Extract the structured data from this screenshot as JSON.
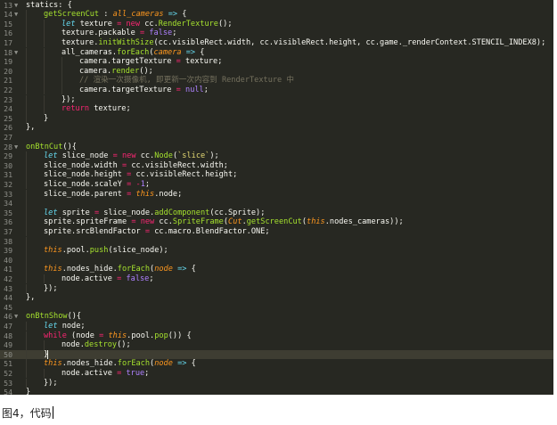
{
  "editor": {
    "theme_colors": {
      "background": "#272822",
      "keyword": "#f92672",
      "string": "#e6db74",
      "function": "#a6e22e",
      "comment": "#75715e"
    },
    "active_line_number": 50,
    "lines": [
      {
        "num": "13",
        "fold": "▼",
        "indent": 1,
        "tokens": [
          [
            "pr",
            "statics: {"
          ]
        ]
      },
      {
        "num": "14",
        "fold": "▼",
        "indent": 2,
        "tokens": [
          [
            "fn",
            "getScreenCut"
          ],
          [
            "pr",
            " : "
          ],
          [
            "pa",
            "all_cameras"
          ],
          [
            "pr",
            " "
          ],
          [
            "st",
            "=>"
          ],
          [
            "pr",
            " {"
          ]
        ]
      },
      {
        "num": "15",
        "fold": "",
        "indent": 3,
        "tokens": [
          [
            "st",
            "let"
          ],
          [
            "pr",
            " texture "
          ],
          [
            "kw",
            "="
          ],
          [
            "pr",
            " "
          ],
          [
            "kw",
            "new"
          ],
          [
            "pr",
            " cc."
          ],
          [
            "fn",
            "RenderTexture"
          ],
          [
            "pr",
            "();"
          ]
        ]
      },
      {
        "num": "16",
        "fold": "",
        "indent": 3,
        "tokens": [
          [
            "pr",
            "texture.packable "
          ],
          [
            "kw",
            "="
          ],
          [
            "pr",
            " "
          ],
          [
            "nu",
            "false"
          ],
          [
            "pr",
            ";"
          ]
        ]
      },
      {
        "num": "17",
        "fold": "",
        "indent": 3,
        "tokens": [
          [
            "pr",
            "texture."
          ],
          [
            "fn",
            "initWithSize"
          ],
          [
            "pr",
            "(cc.visibleRect.width, cc.visibleRect.height, cc.game._renderContext.STENCIL_INDEX8);"
          ]
        ]
      },
      {
        "num": "18",
        "fold": "▼",
        "indent": 3,
        "tokens": [
          [
            "pr",
            "all_cameras."
          ],
          [
            "fn",
            "forEach"
          ],
          [
            "pr",
            "("
          ],
          [
            "pa",
            "camera"
          ],
          [
            "pr",
            " "
          ],
          [
            "st",
            "=>"
          ],
          [
            "pr",
            " {"
          ]
        ]
      },
      {
        "num": "19",
        "fold": "",
        "indent": 4,
        "tokens": [
          [
            "pr",
            "camera.targetTexture "
          ],
          [
            "kw",
            "="
          ],
          [
            "pr",
            " texture;"
          ]
        ]
      },
      {
        "num": "20",
        "fold": "",
        "indent": 4,
        "tokens": [
          [
            "pr",
            "camera."
          ],
          [
            "fn",
            "render"
          ],
          [
            "pr",
            "();"
          ]
        ]
      },
      {
        "num": "21",
        "fold": "",
        "indent": 4,
        "tokens": [
          [
            "cm",
            "// 渲染一次摄像机, 即更新一次内容到 RenderTexture 中"
          ]
        ]
      },
      {
        "num": "22",
        "fold": "",
        "indent": 4,
        "tokens": [
          [
            "pr",
            "camera.targetTexture "
          ],
          [
            "kw",
            "="
          ],
          [
            "pr",
            " "
          ],
          [
            "nu",
            "null"
          ],
          [
            "pr",
            ";"
          ]
        ]
      },
      {
        "num": "23",
        "fold": "",
        "indent": 3,
        "tokens": [
          [
            "pr",
            "});"
          ]
        ]
      },
      {
        "num": "24",
        "fold": "",
        "indent": 3,
        "tokens": [
          [
            "kw",
            "return"
          ],
          [
            "pr",
            " texture;"
          ]
        ]
      },
      {
        "num": "25",
        "fold": "",
        "indent": 2,
        "tokens": [
          [
            "pr",
            "}"
          ]
        ]
      },
      {
        "num": "26",
        "fold": "",
        "indent": 1,
        "tokens": [
          [
            "pr",
            "},"
          ]
        ]
      },
      {
        "num": "27",
        "fold": "",
        "indent": 1,
        "tokens": []
      },
      {
        "num": "28",
        "fold": "▼",
        "indent": 1,
        "tokens": [
          [
            "fn",
            "onBtnCut"
          ],
          [
            "pr",
            "(){"
          ]
        ]
      },
      {
        "num": "29",
        "fold": "",
        "indent": 2,
        "tokens": [
          [
            "st",
            "let"
          ],
          [
            "pr",
            " slice_node "
          ],
          [
            "kw",
            "="
          ],
          [
            "pr",
            " "
          ],
          [
            "kw",
            "new"
          ],
          [
            "pr",
            " cc."
          ],
          [
            "fn",
            "Node"
          ],
          [
            "pr",
            "("
          ],
          [
            "sg",
            "`slice`"
          ],
          [
            "pr",
            ");"
          ]
        ]
      },
      {
        "num": "30",
        "fold": "",
        "indent": 2,
        "tokens": [
          [
            "pr",
            "slice_node.width "
          ],
          [
            "kw",
            "="
          ],
          [
            "pr",
            " cc.visibleRect.width;"
          ]
        ]
      },
      {
        "num": "31",
        "fold": "",
        "indent": 2,
        "tokens": [
          [
            "pr",
            "slice_node.height "
          ],
          [
            "kw",
            "="
          ],
          [
            "pr",
            " cc.visibleRect.height;"
          ]
        ]
      },
      {
        "num": "32",
        "fold": "",
        "indent": 2,
        "tokens": [
          [
            "pr",
            "slice_node.scaleY "
          ],
          [
            "kw",
            "="
          ],
          [
            "pr",
            " "
          ],
          [
            "kw",
            "-"
          ],
          [
            "nu",
            "1"
          ],
          [
            "pr",
            ";"
          ]
        ]
      },
      {
        "num": "33",
        "fold": "",
        "indent": 2,
        "tokens": [
          [
            "pr",
            "slice_node.parent "
          ],
          [
            "kw",
            "="
          ],
          [
            "pr",
            " "
          ],
          [
            "th",
            "this"
          ],
          [
            "pr",
            ".node;"
          ]
        ]
      },
      {
        "num": "34",
        "fold": "",
        "indent": 2,
        "tokens": []
      },
      {
        "num": "35",
        "fold": "",
        "indent": 2,
        "tokens": [
          [
            "st",
            "let"
          ],
          [
            "pr",
            " sprite "
          ],
          [
            "kw",
            "="
          ],
          [
            "pr",
            " slice_node."
          ],
          [
            "fn",
            "addComponent"
          ],
          [
            "pr",
            "(cc.Sprite);"
          ]
        ]
      },
      {
        "num": "36",
        "fold": "",
        "indent": 2,
        "tokens": [
          [
            "pr",
            "sprite.spriteFrame "
          ],
          [
            "kw",
            "="
          ],
          [
            "pr",
            " "
          ],
          [
            "kw",
            "new"
          ],
          [
            "pr",
            " cc."
          ],
          [
            "fn",
            "SpriteFrame"
          ],
          [
            "pr",
            "("
          ],
          [
            "pa",
            "Cut"
          ],
          [
            "pr",
            "."
          ],
          [
            "fn",
            "getScreenCut"
          ],
          [
            "pr",
            "("
          ],
          [
            "th",
            "this"
          ],
          [
            "pr",
            ".nodes_cameras));"
          ]
        ]
      },
      {
        "num": "37",
        "fold": "",
        "indent": 2,
        "tokens": [
          [
            "pr",
            "sprite.srcBlendFactor "
          ],
          [
            "kw",
            "="
          ],
          [
            "pr",
            " cc.macro.BlendFactor.ONE;"
          ]
        ]
      },
      {
        "num": "38",
        "fold": "",
        "indent": 2,
        "tokens": []
      },
      {
        "num": "39",
        "fold": "",
        "indent": 2,
        "tokens": [
          [
            "th",
            "this"
          ],
          [
            "pr",
            ".pool."
          ],
          [
            "fn",
            "push"
          ],
          [
            "pr",
            "(slice_node);"
          ]
        ]
      },
      {
        "num": "40",
        "fold": "",
        "indent": 2,
        "tokens": []
      },
      {
        "num": "41",
        "fold": "",
        "indent": 2,
        "tokens": [
          [
            "th",
            "this"
          ],
          [
            "pr",
            ".nodes_hide."
          ],
          [
            "fn",
            "forEach"
          ],
          [
            "pr",
            "("
          ],
          [
            "pa",
            "node"
          ],
          [
            "pr",
            " "
          ],
          [
            "st",
            "=>"
          ],
          [
            "pr",
            " {"
          ]
        ]
      },
      {
        "num": "42",
        "fold": "",
        "indent": 3,
        "tokens": [
          [
            "pr",
            "node.active "
          ],
          [
            "kw",
            "="
          ],
          [
            "pr",
            " "
          ],
          [
            "nu",
            "false"
          ],
          [
            "pr",
            ";"
          ]
        ]
      },
      {
        "num": "43",
        "fold": "",
        "indent": 2,
        "tokens": [
          [
            "pr",
            "});"
          ]
        ]
      },
      {
        "num": "44",
        "fold": "",
        "indent": 1,
        "tokens": [
          [
            "pr",
            "},"
          ]
        ]
      },
      {
        "num": "45",
        "fold": "",
        "indent": 1,
        "tokens": []
      },
      {
        "num": "46",
        "fold": "▼",
        "indent": 1,
        "tokens": [
          [
            "fn",
            "onBtnShow"
          ],
          [
            "pr",
            "(){"
          ]
        ]
      },
      {
        "num": "47",
        "fold": "",
        "indent": 2,
        "tokens": [
          [
            "st",
            "let"
          ],
          [
            "pr",
            " node;"
          ]
        ]
      },
      {
        "num": "48",
        "fold": "",
        "indent": 2,
        "tokens": [
          [
            "kw",
            "while"
          ],
          [
            "pr",
            " (node "
          ],
          [
            "kw",
            "="
          ],
          [
            "pr",
            " "
          ],
          [
            "th",
            "this"
          ],
          [
            "pr",
            ".pool."
          ],
          [
            "fn",
            "pop"
          ],
          [
            "pr",
            "()) {"
          ]
        ]
      },
      {
        "num": "49",
        "fold": "",
        "indent": 3,
        "tokens": [
          [
            "pr",
            "node."
          ],
          [
            "fn",
            "destroy"
          ],
          [
            "pr",
            "();"
          ]
        ]
      },
      {
        "num": "50",
        "fold": "",
        "indent": 2,
        "tokens": [
          [
            "pr",
            "}"
          ],
          [
            "cursor",
            ""
          ]
        ]
      },
      {
        "num": "51",
        "fold": "",
        "indent": 2,
        "tokens": [
          [
            "th",
            "this"
          ],
          [
            "pr",
            ".nodes_hide."
          ],
          [
            "fn",
            "forEach"
          ],
          [
            "pr",
            "("
          ],
          [
            "pa",
            "node"
          ],
          [
            "pr",
            " "
          ],
          [
            "st",
            "=>"
          ],
          [
            "pr",
            " {"
          ]
        ]
      },
      {
        "num": "52",
        "fold": "",
        "indent": 3,
        "tokens": [
          [
            "pr",
            "node.active "
          ],
          [
            "kw",
            "="
          ],
          [
            "pr",
            " "
          ],
          [
            "nu",
            "true"
          ],
          [
            "pr",
            ";"
          ]
        ]
      },
      {
        "num": "53",
        "fold": "",
        "indent": 2,
        "tokens": [
          [
            "pr",
            "});"
          ]
        ]
      },
      {
        "num": "54",
        "fold": "",
        "indent": 1,
        "tokens": [
          [
            "pr",
            "}"
          ]
        ]
      }
    ]
  },
  "caption": {
    "text": "图4，代码"
  }
}
